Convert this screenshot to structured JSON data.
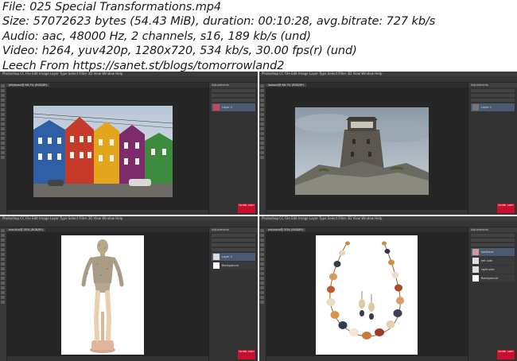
{
  "info": {
    "file": "File: 025 Special Transformations.mp4",
    "size": "Size: 57072623 bytes (54.43 MiB), duration: 00:10:28, avg.bitrate: 727 kb/s",
    "audio": "Audio: aac, 48000 Hz, 2 channels, s16, 189 kb/s (und)",
    "video": "Video: h264, yuv420p, 1280x720, 534 kb/s, 30.00 fps(r) (und)",
    "leech": "Leech From https://sanet.st/blogs/tomorrowland2"
  },
  "thumbnails": [
    {
      "menu": "Photoshop CC  File  Edit  Image  Layer  Type  Select  Filter  3D  View  Window  Help",
      "tab": "jellybean@ 66.7% (RGB/8*)",
      "panel": "Adjustments",
      "layers": [
        "Layer 1"
      ],
      "subject": "colorful-houses"
    },
    {
      "menu": "Photoshop CC  File  Edit  Image  Layer  Type  Select  Filter  3D  View  Window  Help",
      "tab": "lookout@ 66.7% (RGB/8*)",
      "panel": "Adjustments",
      "layers": [
        "Layer 1"
      ],
      "subject": "stone-tower"
    },
    {
      "menu": "Photoshop CC  File  Edit  Image  Layer  Type  Select  Filter  3D  View  Window  Help",
      "tab": "manikin@ 50% (RGB/8*)",
      "panel": "Adjustments",
      "layers": [
        "Layer 1",
        "Background"
      ],
      "subject": "wooden-manikin"
    },
    {
      "menu": "Photoshop CC  File  Edit  Image  Layer  Type  Select  Filter  3D  View  Window  Help",
      "tab": "necklace@ 50% (RGB/8*)",
      "panel": "Adjustments",
      "layers": [
        "necklace",
        "left side",
        "right side",
        "Background"
      ],
      "subject": "gem-necklace"
    }
  ],
  "watermark": "lynda .com"
}
